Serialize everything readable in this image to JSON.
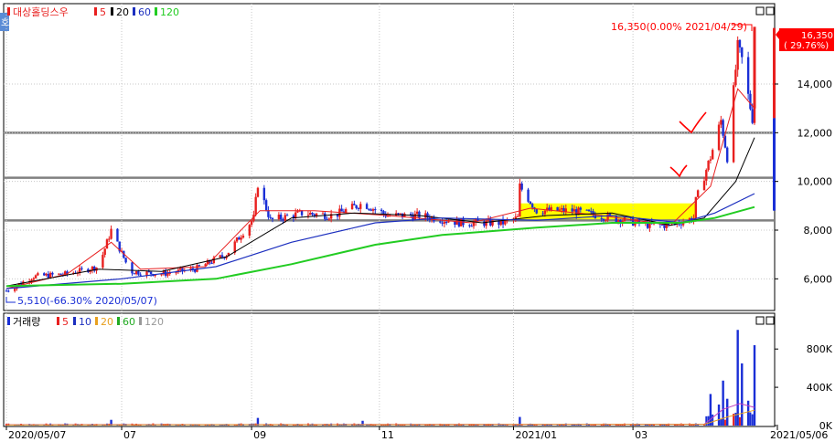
{
  "legend_price": {
    "side_tab": "호",
    "name": "대상홀딩스우",
    "ma5": "5",
    "ma20": "20",
    "ma60": "60",
    "ma120": "120"
  },
  "legend_volume": {
    "name": "거래량",
    "ma5": "5",
    "ma10": "10",
    "ma20": "20",
    "ma60": "60",
    "ma120": "120"
  },
  "colors": {
    "up": "#e8201f",
    "down": "#1a2fd6",
    "ma5": "#e81f1f",
    "ma20": "#000000",
    "ma60": "#1c2fbf",
    "ma120": "#22cc22",
    "highlight": "#ffff00",
    "level": "#808080",
    "annotation": "#ff0000"
  },
  "annotations": {
    "high_label": "16,350(0.00% 2021/04/29)",
    "low_label": "5,510(-66.30% 2020/05/07)",
    "current_value": "16,350",
    "current_pct": "( 29.76%)",
    "checkmarks": [
      "check-mark-1",
      "check-mark-2"
    ]
  },
  "chart_data": {
    "type": "candlestick",
    "x_range": [
      "2020/05/07",
      "2021/05/06"
    ],
    "x_ticks": [
      "2020/05/07",
      "07",
      "09",
      "11",
      "2021/01",
      "03",
      "2021/05/06"
    ],
    "y_ticks": [
      "6,000",
      "8,000",
      "10,000",
      "12,000",
      "14,000"
    ],
    "ylim": [
      4700,
      17300
    ],
    "horizontal_levels": [
      8400,
      10150,
      12000
    ],
    "highlight_zone": {
      "x_start": "2021/01/07",
      "x_end": "2021/04/01",
      "y_low": 8400,
      "y_high": 9100
    },
    "price_path": [
      [
        "2020-05-07",
        5510
      ],
      [
        "2020-05-20",
        6100
      ],
      [
        "2020-06-05",
        6200
      ],
      [
        "2020-06-20",
        6500
      ],
      [
        "2020-06-26",
        8000
      ],
      [
        "2020-07-05",
        6300
      ],
      [
        "2020-07-20",
        6200
      ],
      [
        "2020-08-05",
        6400
      ],
      [
        "2020-08-20",
        7000
      ],
      [
        "2020-09-02",
        8500
      ],
      [
        "2020-09-04",
        9900
      ],
      [
        "2020-09-10",
        8400
      ],
      [
        "2020-09-25",
        8700
      ],
      [
        "2020-10-10",
        8600
      ],
      [
        "2020-10-24",
        9100
      ],
      [
        "2020-11-05",
        8600
      ],
      [
        "2020-11-20",
        8600
      ],
      [
        "2020-12-10",
        8300
      ],
      [
        "2020-12-30",
        8300
      ],
      [
        "2021-01-06",
        8500
      ],
      [
        "2021-01-07",
        9800
      ],
      [
        "2021-01-15",
        8800
      ],
      [
        "2021-02-01",
        8800
      ],
      [
        "2021-02-20",
        8500
      ],
      [
        "2021-03-10",
        8200
      ],
      [
        "2021-03-20",
        8200
      ],
      [
        "2021-03-31",
        8500
      ],
      [
        "2021-04-01",
        9200
      ],
      [
        "2021-04-08",
        11000
      ],
      [
        "2021-04-13",
        12500
      ],
      [
        "2021-04-16",
        11000
      ],
      [
        "2021-04-21",
        15500
      ],
      [
        "2021-04-23",
        15000
      ],
      [
        "2021-04-26",
        13500
      ],
      [
        "2021-04-28",
        12600
      ],
      [
        "2021-04-29",
        16350
      ]
    ],
    "ma_lines": [
      {
        "name": "5",
        "points": [
          [
            "2020-05-07",
            5600
          ],
          [
            "2020-06-05",
            6200
          ],
          [
            "2020-06-26",
            7500
          ],
          [
            "2020-07-10",
            6400
          ],
          [
            "2020-08-10",
            6500
          ],
          [
            "2020-09-05",
            8800
          ],
          [
            "2020-10-01",
            8800
          ],
          [
            "2020-11-05",
            8600
          ],
          [
            "2020-12-15",
            8300
          ],
          [
            "2021-01-12",
            8900
          ],
          [
            "2021-02-15",
            8600
          ],
          [
            "2021-03-20",
            8200
          ],
          [
            "2021-04-08",
            9800
          ],
          [
            "2021-04-21",
            13800
          ],
          [
            "2021-04-29",
            13000
          ]
        ]
      },
      {
        "name": "20",
        "points": [
          [
            "2020-05-07",
            5700
          ],
          [
            "2020-06-20",
            6400
          ],
          [
            "2020-07-20",
            6300
          ],
          [
            "2020-08-20",
            6900
          ],
          [
            "2020-09-20",
            8500
          ],
          [
            "2020-10-20",
            8700
          ],
          [
            "2020-11-20",
            8600
          ],
          [
            "2020-12-20",
            8300
          ],
          [
            "2021-01-20",
            8600
          ],
          [
            "2021-02-20",
            8700
          ],
          [
            "2021-03-20",
            8200
          ],
          [
            "2021-04-05",
            8500
          ],
          [
            "2021-04-20",
            10000
          ],
          [
            "2021-04-29",
            11800
          ]
        ]
      },
      {
        "name": "60",
        "points": [
          [
            "2020-05-07",
            5600
          ],
          [
            "2020-07-01",
            6000
          ],
          [
            "2020-08-15",
            6500
          ],
          [
            "2020-09-20",
            7500
          ],
          [
            "2020-10-30",
            8300
          ],
          [
            "2020-12-01",
            8500
          ],
          [
            "2021-01-15",
            8400
          ],
          [
            "2021-02-20",
            8600
          ],
          [
            "2021-03-25",
            8300
          ],
          [
            "2021-04-10",
            8700
          ],
          [
            "2021-04-29",
            9500
          ]
        ]
      },
      {
        "name": "120",
        "points": [
          [
            "2020-05-07",
            5700
          ],
          [
            "2020-07-01",
            5800
          ],
          [
            "2020-08-15",
            6000
          ],
          [
            "2020-09-20",
            6600
          ],
          [
            "2020-10-30",
            7400
          ],
          [
            "2020-12-01",
            7800
          ],
          [
            "2021-01-15",
            8100
          ],
          [
            "2021-02-20",
            8300
          ],
          [
            "2021-03-25",
            8300
          ],
          [
            "2021-04-10",
            8500
          ],
          [
            "2021-04-29",
            8950
          ]
        ]
      }
    ],
    "volume_y_ticks": [
      "0K",
      "400K",
      "800K"
    ],
    "volume_ylim": [
      0,
      1050
    ],
    "volume_spikes": [
      [
        "2020-06-26",
        60
      ],
      [
        "2020-09-04",
        80
      ],
      [
        "2020-10-24",
        50
      ],
      [
        "2021-01-07",
        90
      ],
      [
        "2021-04-08",
        330
      ],
      [
        "2021-04-12",
        220
      ],
      [
        "2021-04-14",
        470
      ],
      [
        "2021-04-16",
        280
      ],
      [
        "2021-04-21",
        1000
      ],
      [
        "2021-04-23",
        650
      ],
      [
        "2021-04-26",
        260
      ],
      [
        "2021-04-29",
        840
      ]
    ]
  }
}
